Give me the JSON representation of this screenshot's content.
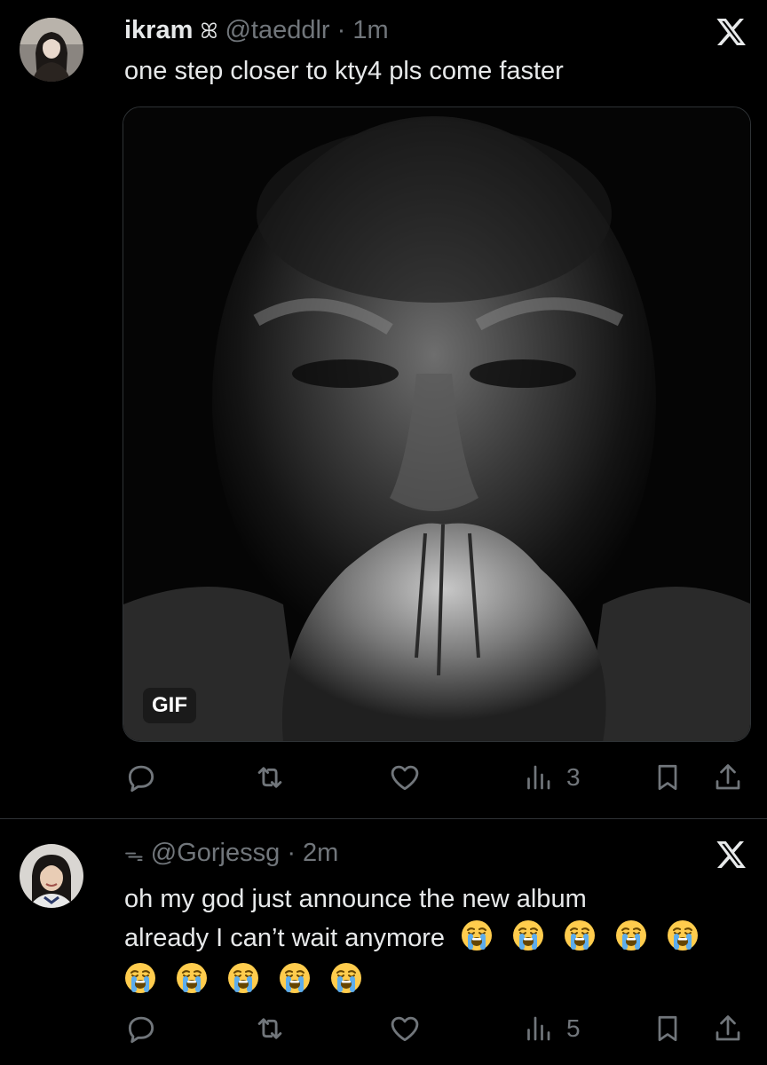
{
  "tweets": [
    {
      "name": "ikram",
      "name_badge": "ꕤ",
      "handle": "@taeddlr",
      "separator": "·",
      "time": "1m",
      "text": "one step closer to kty4 pls come faster",
      "media_badge": "GIF",
      "views": "3"
    },
    {
      "name_badge": "ᯓ",
      "handle": "@Gorjessg",
      "separator": "·",
      "time": "2m",
      "text_line1": "oh my god just announce the new album",
      "text_line2": "already I can’t wait anymore",
      "emoji_count_line2": 5,
      "emoji_count_line3": 5,
      "views": "5"
    }
  ],
  "icons": [
    "x-logo-icon",
    "reply-icon",
    "retweet-icon",
    "like-icon",
    "views-icon",
    "bookmark-icon",
    "share-icon",
    "loudly-crying-face-emoji"
  ],
  "colors": {
    "background": "#000000",
    "text": "#e7e9ea",
    "muted": "#71767b",
    "divider": "#2f3336"
  }
}
